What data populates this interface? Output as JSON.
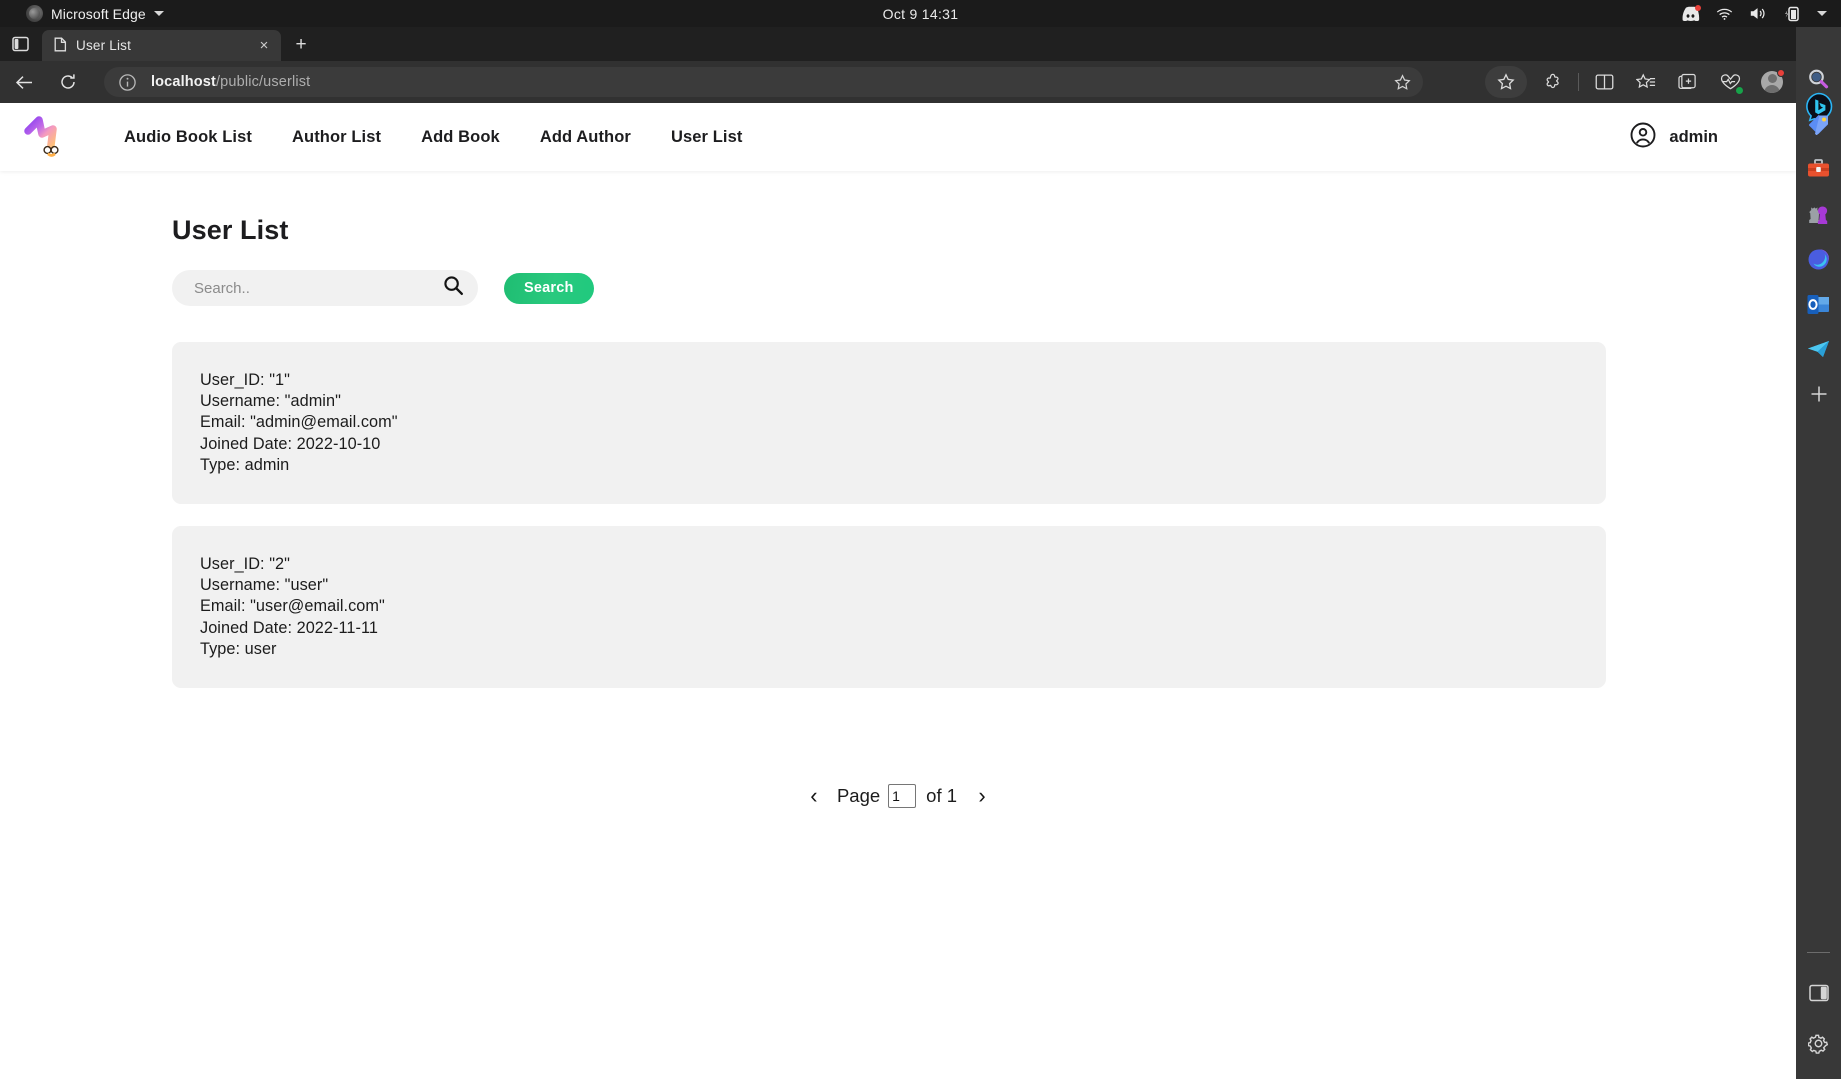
{
  "os": {
    "app_name": "Microsoft Edge",
    "clock": "Oct 9  14:31",
    "tray_icons": [
      "discord-icon",
      "wifi-icon",
      "volume-icon",
      "battery-icon",
      "chevron-down-icon"
    ]
  },
  "browser": {
    "tab": {
      "title": "User List",
      "favicon": "page-icon",
      "close": "×"
    },
    "new_tab_label": "+",
    "window_controls": {
      "minimize": "—",
      "maximize": "□",
      "close": "✕"
    },
    "address": {
      "host": "localhost",
      "path": "/public/userlist",
      "full": "localhost/public/userlist"
    },
    "toolbar_icons": [
      "favorites-star-icon",
      "extensions-icon",
      "split-screen-icon",
      "collections-icon",
      "add-to-collections-icon",
      "browser-essentials-icon",
      "profile-avatar-icon",
      "settings-more-icon",
      "copilot-bing-icon"
    ],
    "edgebar_icons": [
      "search-icon",
      "shopping-tag-icon",
      "tools-briefcase-icon",
      "games-icon",
      "microsoft-365-icon",
      "outlook-icon",
      "telegram-icon",
      "add-icon"
    ],
    "edgebar_bottom_icons": [
      "sidebar-toggle-icon",
      "settings-gear-icon"
    ]
  },
  "site": {
    "logo": "app-logo-icon",
    "nav_links": [
      {
        "label": "Audio Book List",
        "name": "nav-audio-book-list"
      },
      {
        "label": "Author List",
        "name": "nav-author-list"
      },
      {
        "label": "Add Book",
        "name": "nav-add-book"
      },
      {
        "label": "Add Author",
        "name": "nav-add-author"
      },
      {
        "label": "User List",
        "name": "nav-user-list"
      }
    ],
    "account": {
      "icon": "user-circle-icon",
      "name": "admin"
    }
  },
  "main": {
    "title": "User List",
    "search": {
      "placeholder": "Search..",
      "value": "",
      "icon": "search-icon",
      "button_label": "Search"
    },
    "users": [
      {
        "user_id": "User_ID: \"1\"",
        "username": "Username: \"admin\"",
        "email": "Email: \"admin@email.com\"",
        "joined": "Joined Date: 2022-10-10",
        "type": "Type: admin"
      },
      {
        "user_id": "User_ID: \"2\"",
        "username": "Username: \"user\"",
        "email": "Email: \"user@email.com\"",
        "joined": "Joined Date: 2022-11-11",
        "type": "Type: user"
      }
    ],
    "pagination": {
      "prev": "‹",
      "page_label": "Page",
      "current_page": "1",
      "of_label": "of 1",
      "next": "›"
    }
  },
  "colors": {
    "accent_green": "#22c87d",
    "card_bg": "#f1f1f1",
    "page_bg": "#ffffff",
    "chrome_bg": "#313131"
  }
}
